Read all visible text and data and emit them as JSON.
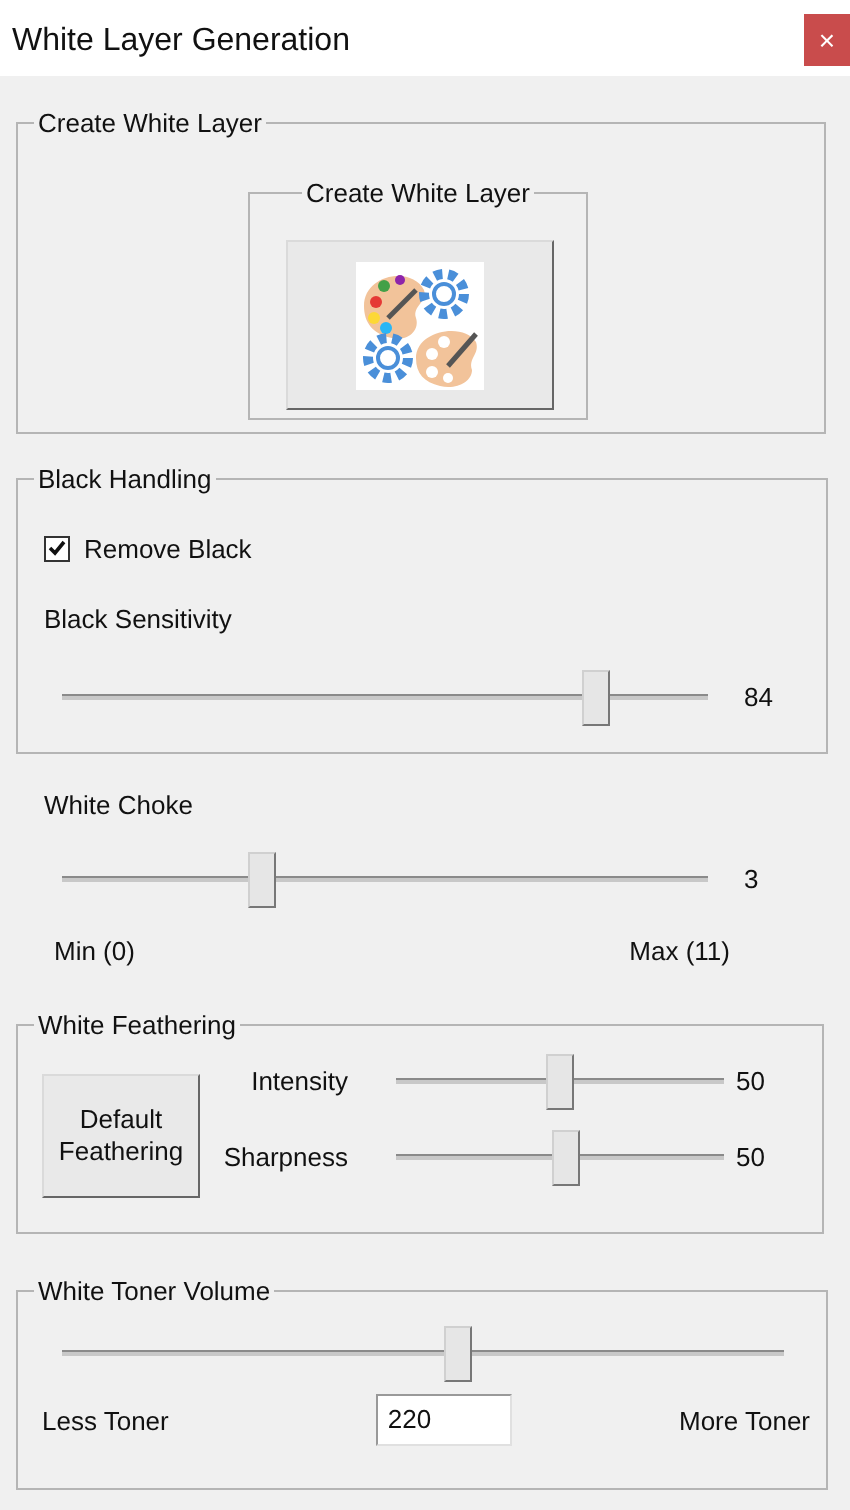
{
  "window": {
    "title": "White Layer Generation",
    "close": "×"
  },
  "create_group": {
    "title": "Create White Layer",
    "inner_title": "Create White Layer"
  },
  "black_handling": {
    "title": "Black Handling",
    "remove_black": {
      "label": "Remove Black",
      "checked": true
    },
    "sensitivity": {
      "label": "Black Sensitivity",
      "level": 0.84,
      "reading": "84"
    }
  },
  "white_choke": {
    "label": "White Choke",
    "level": 0.3,
    "reading": "3",
    "min_label": "Min (0)",
    "max_label": "Max (11)"
  },
  "white_feathering": {
    "title": "White Feathering",
    "button": "Default Feathering",
    "sliders": [
      {
        "label": "Intensity",
        "level": 0.5,
        "reading": "50"
      },
      {
        "label": "Sharpness",
        "level": 0.52,
        "reading": "50"
      }
    ]
  },
  "toner_volume": {
    "title": "White Toner Volume",
    "level": 0.55,
    "less_label": "Less Toner",
    "more_label": "More Toner",
    "value": "220"
  }
}
